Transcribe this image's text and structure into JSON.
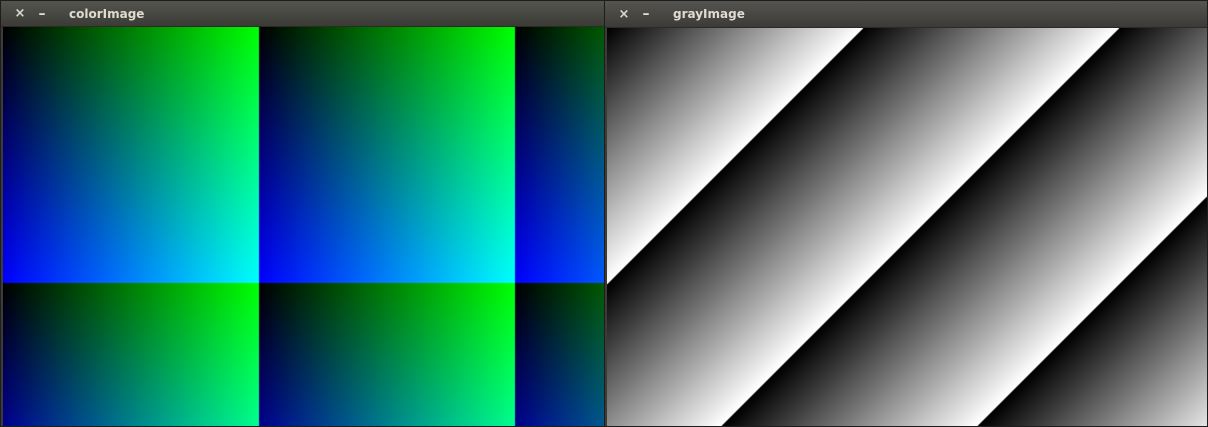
{
  "windows": {
    "color": {
      "title": "colorImage",
      "close_glyph": "×",
      "minimize_glyph": "–"
    },
    "gray": {
      "title": "grayImage",
      "close_glyph": "×",
      "minimize_glyph": "–"
    }
  },
  "icons": {
    "close": "close-icon",
    "minimize": "minimize-icon"
  },
  "colors": {
    "titlebar_text": "#dfdbd2",
    "window_border": "#1d1d1b"
  }
}
